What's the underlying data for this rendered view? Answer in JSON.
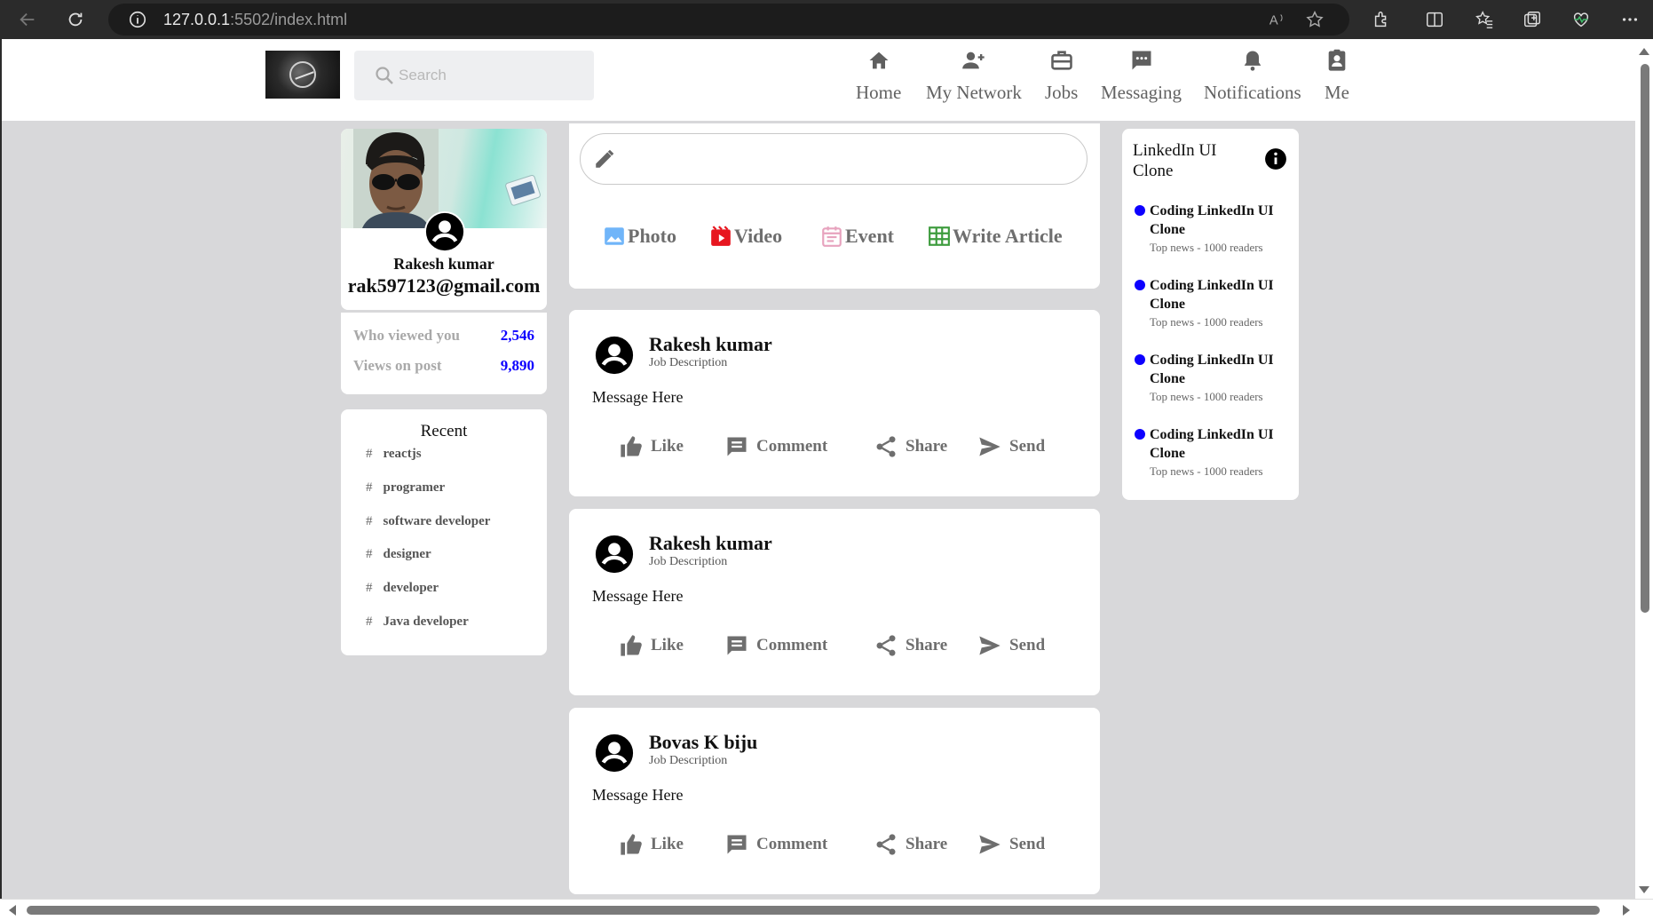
{
  "browser": {
    "url_host": "127.0.0.1",
    "url_rest": ":5502/index.html"
  },
  "search": {
    "placeholder": "Search"
  },
  "nav": [
    {
      "label": "Home",
      "icon": "home-icon"
    },
    {
      "label": "My Network",
      "icon": "network-icon"
    },
    {
      "label": "Jobs",
      "icon": "briefcase-icon"
    },
    {
      "label": "Messaging",
      "icon": "chat-icon"
    },
    {
      "label": "Notifications",
      "icon": "bell-icon"
    },
    {
      "label": "Me",
      "icon": "badge-icon"
    }
  ],
  "profile": {
    "name": "Rakesh kumar",
    "email": "rak597123@gmail.com",
    "stats": [
      {
        "label": "Who viewed you",
        "value": "2,546"
      },
      {
        "label": "Views on post",
        "value": "9,890"
      }
    ]
  },
  "recent": {
    "title": "Recent",
    "tags": [
      "reactjs",
      "programer",
      "software developer",
      "designer",
      "developer",
      "Java developer"
    ]
  },
  "composer": {
    "actions": [
      {
        "label": "Photo",
        "icon": "photo-icon",
        "color": "#70b5f9"
      },
      {
        "label": "Video",
        "icon": "video-icon",
        "color": "#e7161f"
      },
      {
        "label": "Event",
        "icon": "event-icon",
        "color": "#e7a3be"
      },
      {
        "label": "Write Article",
        "icon": "article-icon",
        "color": "#3d9b3d"
      }
    ]
  },
  "posts": [
    {
      "name": "Rakesh kumar",
      "description": "Job Description",
      "message": "Message Here"
    },
    {
      "name": "Rakesh kumar",
      "description": "Job Description",
      "message": "Message Here"
    },
    {
      "name": "Bovas K biju",
      "description": "Job Description",
      "message": "Message Here"
    }
  ],
  "post_actions": {
    "like": "Like",
    "comment": "Comment",
    "share": "Share",
    "send": "Send"
  },
  "news": {
    "title": "LinkedIn UI Clone",
    "items": [
      {
        "title": "Coding LinkedIn UI Clone",
        "subtitle": "Top news - 1000 readers"
      },
      {
        "title": "Coding LinkedIn UI Clone",
        "subtitle": "Top news - 1000 readers"
      },
      {
        "title": "Coding LinkedIn UI Clone",
        "subtitle": "Top news - 1000 readers"
      },
      {
        "title": "Coding LinkedIn UI Clone",
        "subtitle": "Top news - 1000 readers"
      }
    ]
  },
  "colors": {
    "accent_blue": "#0d00ff",
    "page_bg": "#d8d8da"
  }
}
